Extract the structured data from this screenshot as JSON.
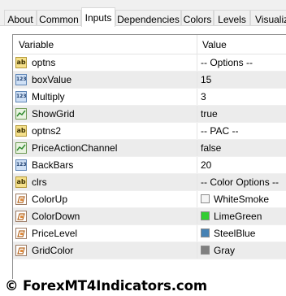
{
  "tabs": [
    {
      "label": "About"
    },
    {
      "label": "Common"
    },
    {
      "label": "Inputs"
    },
    {
      "label": "Dependencies"
    },
    {
      "label": "Colors"
    },
    {
      "label": "Levels"
    },
    {
      "label": "Visualiza"
    }
  ],
  "active_tab": "Inputs",
  "table": {
    "columns": [
      "Variable",
      "Value"
    ],
    "rows": [
      {
        "icon": "string-ab-icon",
        "name": "optns",
        "value": "-- Options --"
      },
      {
        "icon": "integer-123-icon",
        "name": "boxValue",
        "value": "15"
      },
      {
        "icon": "integer-123-icon",
        "name": "Multiply",
        "value": "3"
      },
      {
        "icon": "boolean-icon",
        "name": "ShowGrid",
        "value": "true"
      },
      {
        "icon": "string-ab-icon",
        "name": "optns2",
        "value": "-- PAC --"
      },
      {
        "icon": "boolean-icon",
        "name": "PriceActionChannel",
        "value": "false"
      },
      {
        "icon": "integer-123-icon",
        "name": "BackBars",
        "value": "20"
      },
      {
        "icon": "string-ab-icon",
        "name": "clrs",
        "value": "-- Color Options --"
      },
      {
        "icon": "color-icon",
        "name": "ColorUp",
        "value": "WhiteSmoke",
        "swatch": "#f5f5f5"
      },
      {
        "icon": "color-icon",
        "name": "ColorDown",
        "value": "LimeGreen",
        "swatch": "#32cd32"
      },
      {
        "icon": "color-icon",
        "name": "PriceLevel",
        "value": "SteelBlue",
        "swatch": "#4682b4"
      },
      {
        "icon": "color-icon",
        "name": "GridColor",
        "value": "Gray",
        "swatch": "#808080"
      }
    ]
  },
  "watermark": "© ForexMT4Indicators.com"
}
